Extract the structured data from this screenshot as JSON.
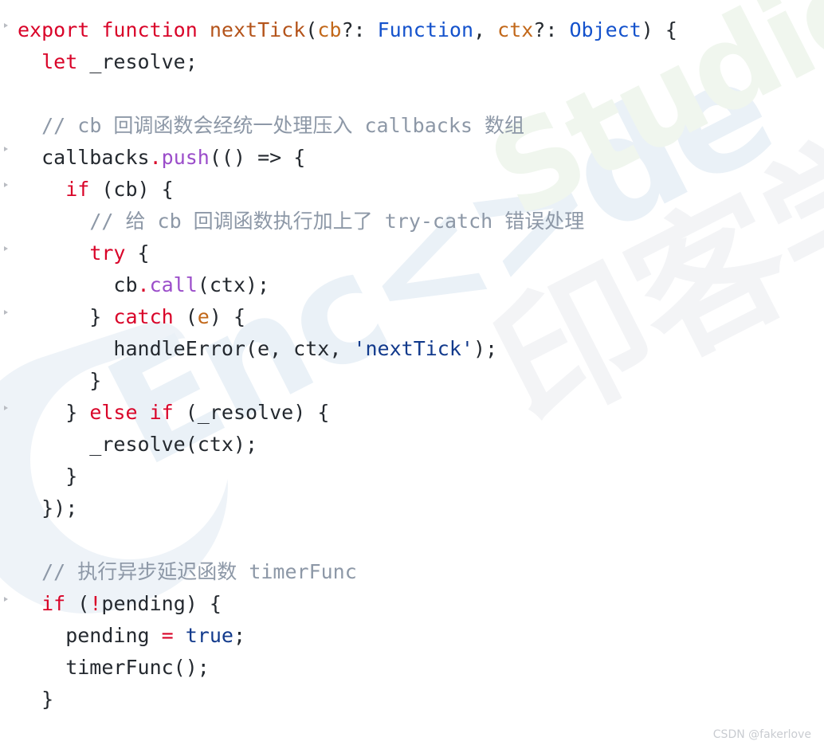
{
  "page": {
    "kind": "code-snippet",
    "language": "javascript",
    "background_color": "#ffffff"
  },
  "colors": {
    "keyword": "#d90429",
    "function_name": "#b4541b",
    "parameter": "#c2681a",
    "type": "#1452cc",
    "string": "#123a8c",
    "method": "#9b4dca",
    "comment": "#8d98a7",
    "plain": "#24292f",
    "operator": "#d90429",
    "watermark_blue": "#eaf1f7",
    "watermark_green": "#f0f6ee",
    "watermark_gray": "#f3f4f6",
    "credit": "#c9ccd1"
  },
  "watermark": {
    "encode_text": "Enc<>de",
    "studio_text": "Studio",
    "chinese_text": "印客学院"
  },
  "credit": {
    "text": "CSDN @fakerlove"
  },
  "gutter": {
    "fold_marker_tops": [
      29,
      184,
      229,
      309,
      389,
      509,
      749
    ]
  },
  "code": {
    "lines": [
      {
        "n": 1,
        "text": "export function nextTick(cb?: Function, ctx?: Object) {",
        "tokens": [
          {
            "t": "export",
            "c": "kw"
          },
          {
            "t": " ",
            "c": "pln"
          },
          {
            "t": "function",
            "c": "kw"
          },
          {
            "t": " ",
            "c": "pln"
          },
          {
            "t": "nextTick",
            "c": "fn"
          },
          {
            "t": "(",
            "c": "pln"
          },
          {
            "t": "cb",
            "c": "param"
          },
          {
            "t": "?: ",
            "c": "pln"
          },
          {
            "t": "Function",
            "c": "type"
          },
          {
            "t": ", ",
            "c": "pln"
          },
          {
            "t": "ctx",
            "c": "param"
          },
          {
            "t": "?: ",
            "c": "pln"
          },
          {
            "t": "Object",
            "c": "type"
          },
          {
            "t": ") {",
            "c": "pln"
          }
        ]
      },
      {
        "n": 2,
        "text": "  let _resolve;",
        "tokens": [
          {
            "t": "  ",
            "c": "pln"
          },
          {
            "t": "let",
            "c": "kw"
          },
          {
            "t": " _resolve;",
            "c": "pln"
          }
        ]
      },
      {
        "n": 3,
        "text": "",
        "tokens": []
      },
      {
        "n": 4,
        "text": "  // cb 回调函数会经统一处理压入 callbacks 数组",
        "tokens": [
          {
            "t": "  ",
            "c": "pln"
          },
          {
            "t": "// cb 回调函数会经统一处理压入 callbacks 数组",
            "c": "cmt"
          }
        ]
      },
      {
        "n": 5,
        "text": "  callbacks.push(() => {",
        "tokens": [
          {
            "t": "  callbacks",
            "c": "pln"
          },
          {
            "t": ".",
            "c": "dot"
          },
          {
            "t": "push",
            "c": "meth"
          },
          {
            "t": "(() => {",
            "c": "pln"
          }
        ]
      },
      {
        "n": 6,
        "text": "    if (cb) {",
        "tokens": [
          {
            "t": "    ",
            "c": "pln"
          },
          {
            "t": "if",
            "c": "kw"
          },
          {
            "t": " (cb) {",
            "c": "pln"
          }
        ]
      },
      {
        "n": 7,
        "text": "      // 给 cb 回调函数执行加上了 try-catch 错误处理",
        "tokens": [
          {
            "t": "      ",
            "c": "pln"
          },
          {
            "t": "// 给 cb 回调函数执行加上了 try-catch 错误处理",
            "c": "cmt"
          }
        ]
      },
      {
        "n": 8,
        "text": "      try {",
        "tokens": [
          {
            "t": "      ",
            "c": "pln"
          },
          {
            "t": "try",
            "c": "kw"
          },
          {
            "t": " {",
            "c": "pln"
          }
        ]
      },
      {
        "n": 9,
        "text": "        cb.call(ctx);",
        "tokens": [
          {
            "t": "        cb",
            "c": "pln"
          },
          {
            "t": ".",
            "c": "dot"
          },
          {
            "t": "call",
            "c": "meth"
          },
          {
            "t": "(ctx);",
            "c": "pln"
          }
        ]
      },
      {
        "n": 10,
        "text": "      } catch (e) {",
        "tokens": [
          {
            "t": "      } ",
            "c": "pln"
          },
          {
            "t": "catch",
            "c": "kw"
          },
          {
            "t": " (",
            "c": "pln"
          },
          {
            "t": "e",
            "c": "param"
          },
          {
            "t": ") {",
            "c": "pln"
          }
        ]
      },
      {
        "n": 11,
        "text": "        handleError(e, ctx, 'nextTick');",
        "tokens": [
          {
            "t": "        handleError(e, ctx, ",
            "c": "pln"
          },
          {
            "t": "'nextTick'",
            "c": "str"
          },
          {
            "t": ");",
            "c": "pln"
          }
        ]
      },
      {
        "n": 12,
        "text": "      }",
        "tokens": [
          {
            "t": "      }",
            "c": "pln"
          }
        ]
      },
      {
        "n": 13,
        "text": "    } else if (_resolve) {",
        "tokens": [
          {
            "t": "    } ",
            "c": "pln"
          },
          {
            "t": "else",
            "c": "kw"
          },
          {
            "t": " ",
            "c": "pln"
          },
          {
            "t": "if",
            "c": "kw"
          },
          {
            "t": " (_resolve) {",
            "c": "pln"
          }
        ]
      },
      {
        "n": 14,
        "text": "      _resolve(ctx);",
        "tokens": [
          {
            "t": "      _resolve(ctx);",
            "c": "pln"
          }
        ]
      },
      {
        "n": 15,
        "text": "    }",
        "tokens": [
          {
            "t": "    }",
            "c": "pln"
          }
        ]
      },
      {
        "n": 16,
        "text": "  });",
        "tokens": [
          {
            "t": "  });",
            "c": "pln"
          }
        ]
      },
      {
        "n": 17,
        "text": "",
        "tokens": []
      },
      {
        "n": 18,
        "text": "  // 执行异步延迟函数 timerFunc",
        "tokens": [
          {
            "t": "  ",
            "c": "pln"
          },
          {
            "t": "// 执行异步延迟函数 timerFunc",
            "c": "cmt"
          }
        ]
      },
      {
        "n": 19,
        "text": "  if (!pending) {",
        "tokens": [
          {
            "t": "  ",
            "c": "pln"
          },
          {
            "t": "if",
            "c": "kw"
          },
          {
            "t": " (",
            "c": "pln"
          },
          {
            "t": "!",
            "c": "op"
          },
          {
            "t": "pending) {",
            "c": "pln"
          }
        ]
      },
      {
        "n": 20,
        "text": "    pending = true;",
        "tokens": [
          {
            "t": "    pending ",
            "c": "pln"
          },
          {
            "t": "=",
            "c": "op"
          },
          {
            "t": " ",
            "c": "pln"
          },
          {
            "t": "true",
            "c": "bool"
          },
          {
            "t": ";",
            "c": "pln"
          }
        ]
      },
      {
        "n": 21,
        "text": "    timerFunc();",
        "tokens": [
          {
            "t": "    timerFunc();",
            "c": "pln"
          }
        ]
      },
      {
        "n": 22,
        "text": "  }",
        "tokens": [
          {
            "t": "  }",
            "c": "pln"
          }
        ]
      }
    ]
  }
}
